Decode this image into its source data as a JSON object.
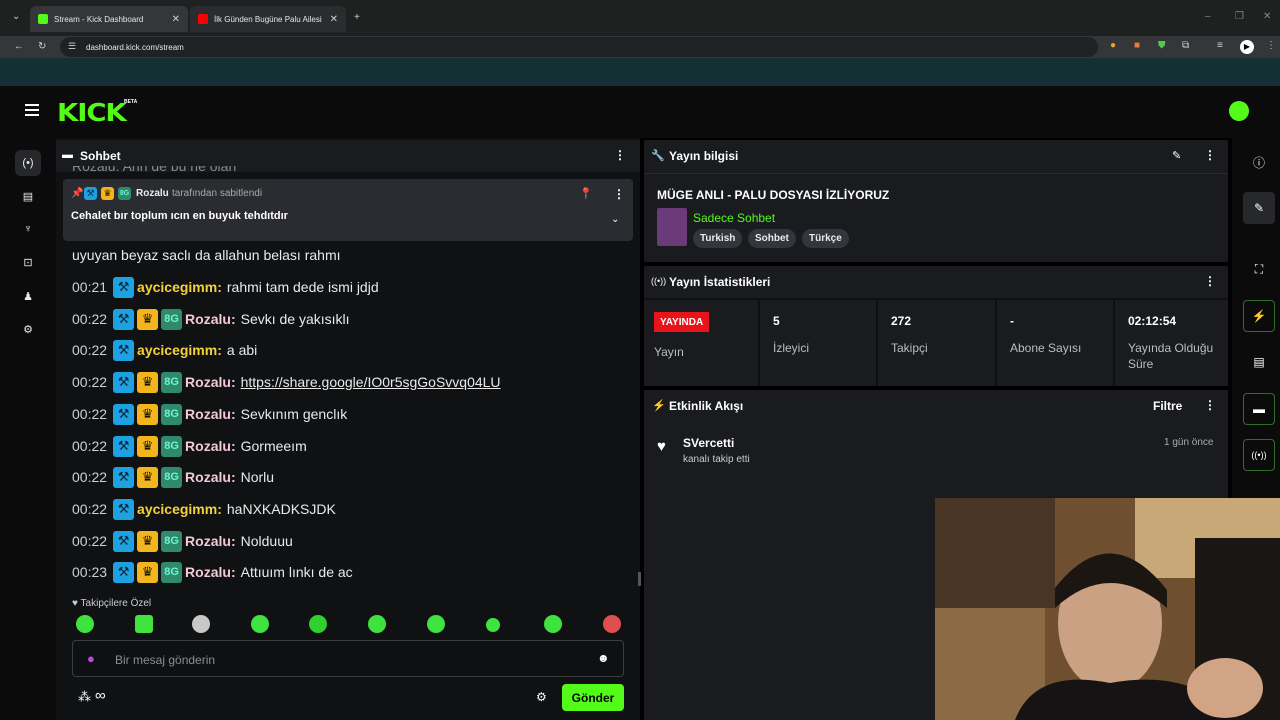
{
  "browser": {
    "tabs": [
      {
        "title": "Stream - Kick Dashboard",
        "active": true
      },
      {
        "title": "İlk Günden Bugüne Palu Ailesi |",
        "active": false
      }
    ],
    "url": "dashboard.kick.com/stream"
  },
  "header": {
    "logo": "KICK",
    "beta": "BETA"
  },
  "chat": {
    "title": "Sohbet",
    "partial_top": "Rozalu: Ahh de bu ne olan",
    "pinned": {
      "user": "Rozalu",
      "pinned_by": "tarafından sabitlendi",
      "text": "Cehalet bır toplum ıcın en buyuk tehdıtdır"
    },
    "continuation": "uyuyan beyaz saclı da allahun belası rahmı",
    "messages": [
      {
        "time": "00:21",
        "user": "aycicegimm",
        "text": "rahmi tam dede ismi jdjd",
        "badges": [
          "hammer"
        ],
        "color": "yellow"
      },
      {
        "time": "00:22",
        "user": "Rozalu",
        "text": "Sevkı de yakısıklı",
        "badges": [
          "hammer",
          "crown",
          "og"
        ],
        "color": "pink"
      },
      {
        "time": "00:22",
        "user": "aycicegimm",
        "text": "a abi",
        "badges": [
          "hammer"
        ],
        "color": "yellow"
      },
      {
        "time": "00:22",
        "user": "Rozalu",
        "text": "https://share.google/IO0r5sgGoSvvq04LU",
        "badges": [
          "hammer",
          "crown",
          "og"
        ],
        "color": "pink",
        "link": true
      },
      {
        "time": "00:22",
        "user": "Rozalu",
        "text": "Sevkınım genclık",
        "badges": [
          "hammer",
          "crown",
          "og"
        ],
        "color": "pink"
      },
      {
        "time": "00:22",
        "user": "Rozalu",
        "text": "Gormeeım",
        "badges": [
          "hammer",
          "crown",
          "og"
        ],
        "color": "pink"
      },
      {
        "time": "00:22",
        "user": "Rozalu",
        "text": "Norlu",
        "badges": [
          "hammer",
          "crown",
          "og"
        ],
        "color": "pink"
      },
      {
        "time": "00:22",
        "user": "aycicegimm",
        "text": "haNXKADKSJDK",
        "badges": [
          "hammer"
        ],
        "color": "yellow"
      },
      {
        "time": "00:22",
        "user": "Rozalu",
        "text": "Nolduuu",
        "badges": [
          "hammer",
          "crown",
          "og"
        ],
        "color": "pink"
      },
      {
        "time": "00:23",
        "user": "Rozalu",
        "text": "Attıuım lınkı de ac",
        "badges": [
          "hammer",
          "crown",
          "og"
        ],
        "color": "pink"
      }
    ],
    "emote_section_label": "Takipçilere Özel",
    "input_placeholder": "Bir mesaj gönderin",
    "send_label": "Gönder",
    "infinity": "∞"
  },
  "stream_info": {
    "title": "Yayın bilgisi",
    "stream_title": "MÜGE ANLI - PALU DOSYASI İZLİYORUZ",
    "category": "Sadece Sohbet",
    "tags": [
      "Turkish",
      "Sohbet",
      "Türkçe"
    ]
  },
  "stats": {
    "title": "Yayın İstatistikleri",
    "live_badge": "YAYINDA",
    "live_label": "Yayın",
    "items": [
      {
        "value": "5",
        "label": "İzleyici"
      },
      {
        "value": "272",
        "label": "Takipçi"
      },
      {
        "value": "-",
        "label": "Abone Sayısı"
      },
      {
        "value": "02:12:54",
        "label": "Yayında Olduğu Süre"
      }
    ]
  },
  "activity": {
    "title": "Etkinlik Akışı",
    "filter_label": "Filtre",
    "items": [
      {
        "user": "SVercetti",
        "action": "kanalı takip etti",
        "time": "1 gün önce"
      }
    ]
  },
  "colors": {
    "accent": "#53fc18",
    "live": "#e9131a",
    "yellow_user": "#f5d13c",
    "pink_user": "#f4c8d4"
  }
}
